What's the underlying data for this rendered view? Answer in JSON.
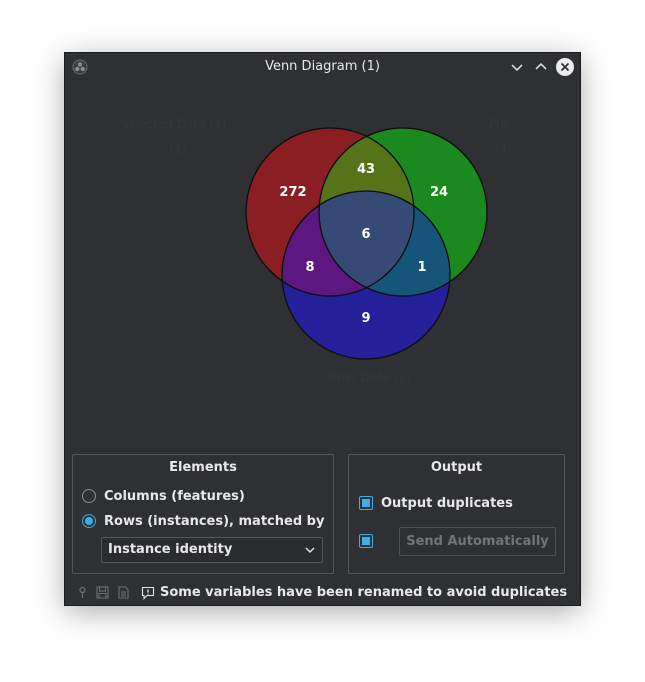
{
  "window": {
    "title": "Venn Diagram (1)"
  },
  "venn": {
    "faint_labels": [
      "Selected Data (1)",
      "(3)",
      "Pro",
      "(4)",
      "Other Data (2)"
    ],
    "regions": {
      "a_only": "272",
      "b_only": "24",
      "c_only": "9",
      "ab": "43",
      "ac": "8",
      "bc": "1",
      "abc": "6"
    },
    "colors": {
      "a": "#8b1e22",
      "b": "#1a8a1f",
      "c": "#24209a",
      "ab": "#55741a",
      "ac": "#5c1880",
      "bc": "#16557a",
      "abc": "#354a74"
    }
  },
  "elements_group": {
    "title": "Elements",
    "option_columns": "Columns (features)",
    "option_rows": "Rows (instances), matched by",
    "selected": "rows",
    "match_by_value": "Instance identity"
  },
  "output_group": {
    "title": "Output",
    "output_duplicates_label": "Output duplicates",
    "output_duplicates_checked": true,
    "auto_send_checked": true,
    "send_label": "Send Automatically"
  },
  "status_bar": {
    "icons": [
      "help-icon",
      "save-icon",
      "report-icon",
      "warning-icon"
    ],
    "message": "Some variables have been renamed to avoid duplicates"
  }
}
